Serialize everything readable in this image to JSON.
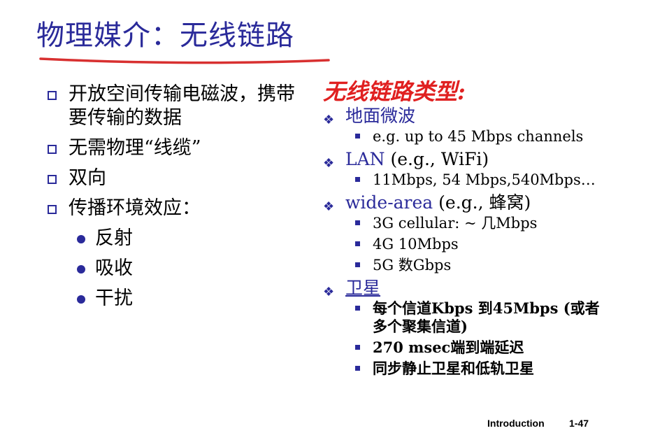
{
  "slide": {
    "title": "物理媒介：无线链路",
    "left_bullets": [
      "开放空间传输电磁波，携带要传输的数据",
      "无需物理“线缆”",
      "双向",
      "传播环境效应："
    ],
    "left_sub_bullets": [
      "反射",
      "吸收",
      "干扰"
    ],
    "right_title": "无线链路类型:",
    "right_sections": [
      {
        "head_main": "地面微波",
        "head_rest": "",
        "items": [
          "e.g. up to 45 Mbps channels"
        ]
      },
      {
        "head_main": "LAN",
        "head_rest": " (e.g., WiFi)",
        "items": [
          "11Mbps, 54 Mbps,540Mbps…"
        ]
      },
      {
        "head_main": "wide-area",
        "head_rest": " (e.g., 蜂窝)",
        "items": [
          "3G cellular: ~ 几Mbps",
          "4G 10Mbps",
          "5G 数Gbps"
        ]
      },
      {
        "head_main": "卫星",
        "head_rest": "",
        "items": [
          "每个信道Kbps 到45Mbps (或者多个聚集信道)",
          "270 msec端到端延迟",
          "同步静止卫星和低轨卫星"
        ]
      }
    ],
    "footer_label": "Introduction",
    "page_number": "1-47"
  },
  "colors": {
    "title": "#2a2a9a",
    "accent_red": "#e02020",
    "bullet": "#2a2a9a"
  }
}
